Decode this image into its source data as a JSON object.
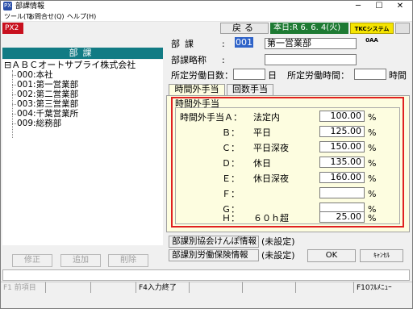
{
  "window": {
    "app_icon": "PX",
    "title": "部課情報",
    "min_symbol": "─",
    "max_symbol": "☐",
    "close_symbol": "✕"
  },
  "menu": [
    "ツール(T)",
    "お問合せ(Q)",
    "ヘルプ(H)"
  ],
  "toolbar": {
    "badge": "PX2",
    "back_label": "戻る",
    "today_label": "本日:R 6. 6. 4(火)",
    "tkc_label": "TKCシステム0AA"
  },
  "tree": {
    "header": "部課",
    "root": "ＡＢＣオートサプライ株式会社",
    "root_toggle": "⊟",
    "items": [
      "000:本社",
      "001:第一営業部",
      "002:第二営業部",
      "003:第三営業部",
      "004:千葉営業所",
      "009:総務部"
    ]
  },
  "left_buttons": {
    "edit": "修正",
    "add": "追加",
    "delete": "削除"
  },
  "form": {
    "dept_label": "部課",
    "colon": ":",
    "dept_code": "001",
    "dept_name": "第一営業部",
    "abbr_label": "部課略称",
    "abbr_value": "",
    "work_days_label": "所定労働日数：",
    "work_days_unit": "日",
    "work_days_value": "",
    "work_hours_label": "所定労働時間：",
    "work_hours_unit": "時間",
    "work_hours_value": ""
  },
  "tabs": [
    "時間外手当",
    "回数手当"
  ],
  "overtime": {
    "title": "時間外手当",
    "unit": "%",
    "rows": [
      {
        "key": "時間外手当Ａ：",
        "name": "法定内",
        "value": "100.00"
      },
      {
        "key": "Ｂ：",
        "name": "平日",
        "value": "125.00"
      },
      {
        "key": "Ｃ：",
        "name": "平日深夜",
        "value": "150.00"
      },
      {
        "key": "Ｄ：",
        "name": "休日",
        "value": "135.00"
      },
      {
        "key": "Ｅ：",
        "name": "休日深夜",
        "value": "160.00"
      },
      {
        "key": "Ｆ：",
        "name": "",
        "value": ""
      },
      {
        "key": "Ｇ：",
        "name": "",
        "value": ""
      },
      {
        "key": "Ｈ：",
        "name": "６０ｈ超",
        "value": "25.00"
      }
    ]
  },
  "info_buttons": {
    "kenpo": "部課別協会けんぽ情報",
    "kenpo_status": "(未設定)",
    "rousai": "部課別労働保険情報",
    "rousai_status": "(未設定)"
  },
  "actions": {
    "ok": "OK",
    "cancel": "ｷｬﾝｾﾙ"
  },
  "fkeys": [
    "F1 前項目",
    "",
    "",
    "F4入力終了",
    "",
    "",
    "",
    "F10ﾌﾙﾒﾆｭｰ"
  ]
}
